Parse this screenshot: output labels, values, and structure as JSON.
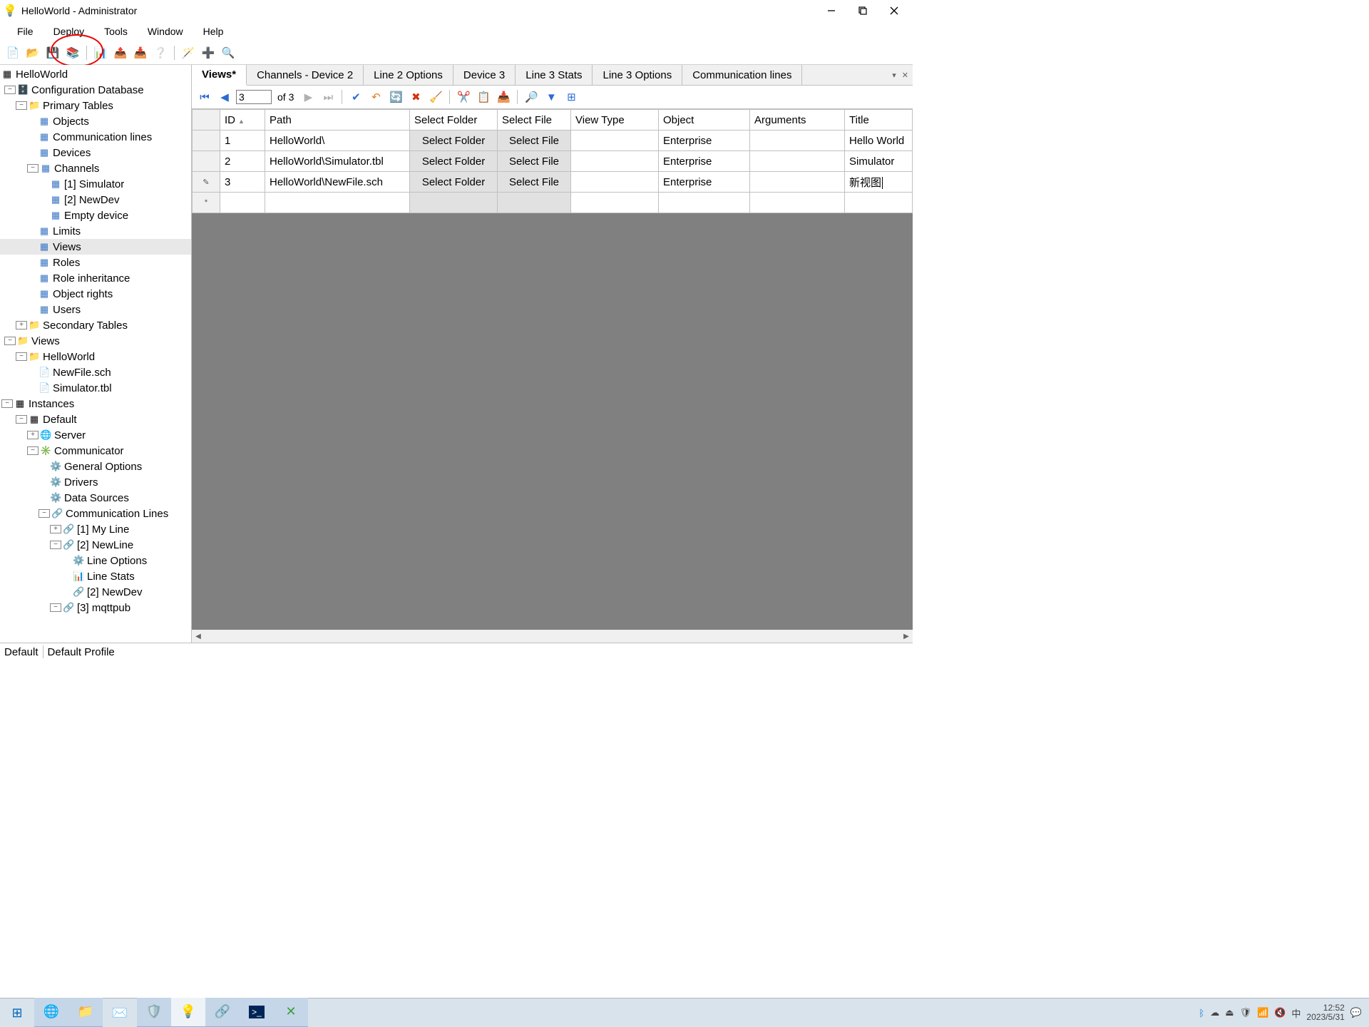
{
  "window": {
    "title": "HelloWorld - Administrator"
  },
  "menu": {
    "file": "File",
    "deploy": "Deploy",
    "tools": "Tools",
    "window": "Window",
    "help": "Help"
  },
  "tree": {
    "root": "HelloWorld",
    "cfgdb": "Configuration Database",
    "primary": "Primary Tables",
    "objects": "Objects",
    "commlines": "Communication lines",
    "devices": "Devices",
    "channels": "Channels",
    "ch1": "[1] Simulator",
    "ch2": "[2] NewDev",
    "ch3": "Empty device",
    "limits": "Limits",
    "views": "Views",
    "roles": "Roles",
    "roleinh": "Role inheritance",
    "objrights": "Object rights",
    "users": "Users",
    "secondary": "Secondary Tables",
    "viewsRoot": "Views",
    "hw": "HelloWorld",
    "newfile": "NewFile.sch",
    "simtbl": "Simulator.tbl",
    "instances": "Instances",
    "default": "Default",
    "server": "Server",
    "communicator": "Communicator",
    "genopt": "General Options",
    "drivers": "Drivers",
    "datasrc": "Data Sources",
    "commlines2": "Communication Lines",
    "myline": "[1] My Line",
    "newline": "[2] NewLine",
    "lineopt": "Line Options",
    "linestats": "Line Stats",
    "newdev2": "[2] NewDev",
    "mqttpub": "[3] mqttpub"
  },
  "tabs": {
    "views": "Views*",
    "t2": "Channels - Device 2",
    "t3": "Line 2 Options",
    "t4": "Device 3",
    "t5": "Line 3 Stats",
    "t6": "Line 3 Options",
    "t7": "Communication lines"
  },
  "gridnav": {
    "current": "3",
    "of": "of 3"
  },
  "columns": {
    "id": "ID",
    "path": "Path",
    "selfolder": "Select Folder",
    "selfile": "Select File",
    "viewtype": "View Type",
    "object": "Object",
    "arguments": "Arguments",
    "title": "Title"
  },
  "rows": [
    {
      "id": "1",
      "path": "HelloWorld\\",
      "sf": "Select Folder",
      "sfi": "Select File",
      "vt": "",
      "obj": "Enterprise",
      "arg": "",
      "title": "Hello World"
    },
    {
      "id": "2",
      "path": "HelloWorld\\Simulator.tbl",
      "sf": "Select Folder",
      "sfi": "Select File",
      "vt": "",
      "obj": "Enterprise",
      "arg": "",
      "title": "Simulator"
    },
    {
      "id": "3",
      "path": "HelloWorld\\NewFile.sch",
      "sf": "Select Folder",
      "sfi": "Select File",
      "vt": "",
      "obj": "Enterprise",
      "arg": "",
      "title": "新视图"
    }
  ],
  "status": {
    "default": "Default",
    "profile": "Default Profile"
  },
  "clock": {
    "time": "12:52",
    "date": "2023/5/31"
  },
  "ime": "中"
}
